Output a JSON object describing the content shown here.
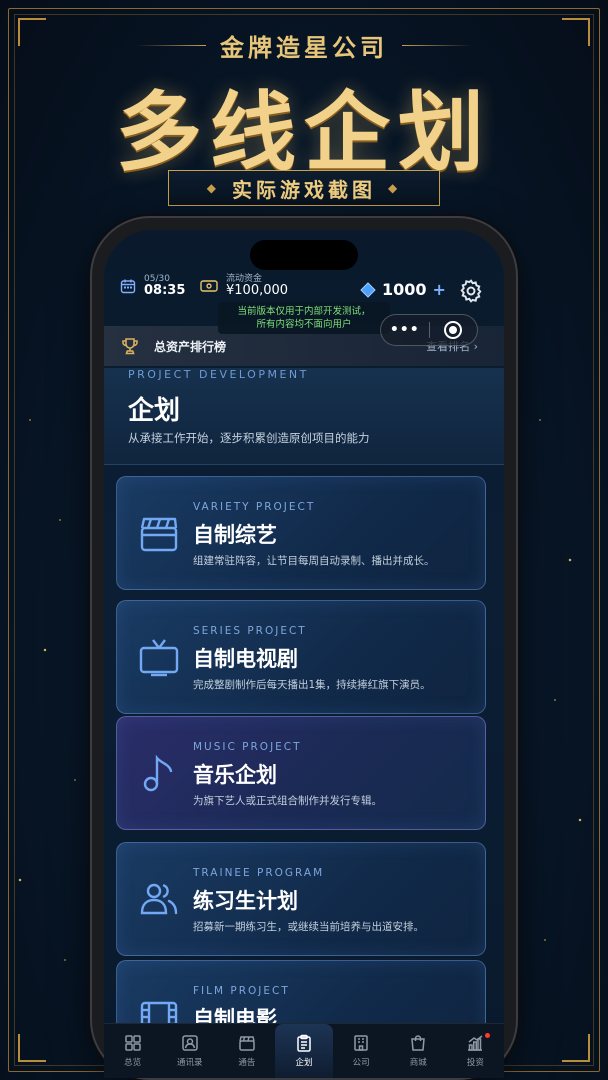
{
  "promo": {
    "subtitle": "金牌造星公司",
    "title": "多线企划",
    "badge": "实际游戏截图"
  },
  "status": {
    "date": "05/30",
    "time": "08:35",
    "money_label": "流动资金",
    "money_value": "¥100,000",
    "gems": "1000",
    "gems_plus": "+"
  },
  "notice": {
    "line1": "当前版本仅用于内部开发测试，",
    "line2": "所有内容均不面向用户"
  },
  "miniprogram": {
    "dots": "•••"
  },
  "rank": {
    "label": "总资产排行榜",
    "link": "查看排名 ›"
  },
  "hero": {
    "eyebrow": "PROJECT DEVELOPMENT",
    "title": "企划",
    "desc": "从承接工作开始，逐步积累创造原创项目的能力"
  },
  "cards": [
    {
      "eyebrow": "VARIETY PROJECT",
      "name": "自制综艺",
      "desc": "组建常驻阵容，让节目每周自动录制、播出并成长。",
      "icon": "clapperboard-icon"
    },
    {
      "eyebrow": "SERIES PROJECT",
      "name": "自制电视剧",
      "desc": "完成整剧制作后每天播出1集，持续捧红旗下演员。",
      "icon": "tv-icon"
    },
    {
      "eyebrow": "MUSIC PROJECT",
      "name": "音乐企划",
      "desc": "为旗下艺人或正式组合制作并发行专辑。",
      "icon": "music-note-icon"
    },
    {
      "eyebrow": "TRAINEE PROGRAM",
      "name": "练习生计划",
      "desc": "招募新一期练习生，或继续当前培养与出道安排。",
      "icon": "users-icon"
    },
    {
      "eyebrow": "FILM PROJECT",
      "name": "自制电影",
      "desc": "",
      "icon": "film-icon"
    }
  ],
  "tabs": [
    {
      "label": "总览",
      "icon": "overview-icon"
    },
    {
      "label": "通讯录",
      "icon": "contacts-icon"
    },
    {
      "label": "通告",
      "icon": "clapper-icon"
    },
    {
      "label": "企划",
      "icon": "clipboard-icon",
      "active": true
    },
    {
      "label": "公司",
      "icon": "building-icon"
    },
    {
      "label": "商城",
      "icon": "shopping-bag-icon"
    },
    {
      "label": "投资",
      "icon": "chart-icon",
      "badge": true
    }
  ],
  "colors": {
    "accent": "#72a8f4",
    "gold": "#f2d28a",
    "notice": "#7fe07a"
  }
}
